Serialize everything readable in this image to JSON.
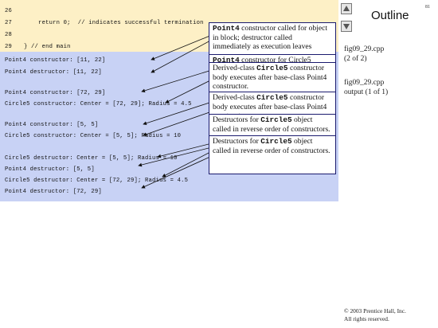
{
  "page_number": "81",
  "outline_title": "Outline",
  "nav": {
    "prev_icon": "up-arrow-icon",
    "next_icon": "down-arrow-icon"
  },
  "side": {
    "file1": "fig09_29.cpp",
    "file1_sub": "(2 of 2)",
    "file2": "fig09_29.cpp",
    "file2_sub": "output (1 of 1)"
  },
  "copyright": {
    "line1": "© 2003 Prentice Hall, Inc.",
    "line2": "All rights reserved."
  },
  "code": {
    "line26": {
      "no": "26",
      "text": ""
    },
    "line27": {
      "no": "27",
      "text": "    return 0;  // indicates successful termination"
    },
    "line28": {
      "no": "28",
      "text": ""
    },
    "line29": {
      "no": "29",
      "text": "} // end main"
    }
  },
  "output": [
    "Point4 constructor: [11, 22]",
    "Point4 destructor: [11, 22]",
    "",
    "Point4 constructor: [72, 29]",
    "Circle5 constructor: Center = [72, 29]; Radius = 4.5",
    "",
    "Point4 constructor: [5, 5]",
    "Circle5 constructor: Center = [5, 5]; Radius = 10",
    "",
    "Circle5 destructor: Center = [5, 5]; Radius = 10",
    "Point4 destructor: [5, 5]",
    "Circle5 destructor: Center = [72, 29]; Radius = 4.5",
    "Point4 destructor: [72, 29]"
  ],
  "callouts": {
    "c1": {
      "code": "Point4",
      "text": " constructor called for object in block; destructor called immediately as execution leaves scope."
    },
    "c2": {
      "code": "Point4",
      "text": " constructor for Circle5 object."
    },
    "c3": {
      "pre": "Derived-class ",
      "code": "Circle5",
      "text": " constructor body executes after base-class Point4 constructor."
    },
    "c4": {
      "pre": "Derived-class ",
      "code": "Circle5",
      "text": " constructor body executes after base-class Point4 constructor."
    },
    "c5": {
      "pre": "Destructors for ",
      "code": "Circle5",
      "text": " object called in reverse order of constructors."
    },
    "c6": {
      "pre": "Destructors for ",
      "code": "Circle5",
      "text": " object called in reverse order of constructors."
    }
  }
}
